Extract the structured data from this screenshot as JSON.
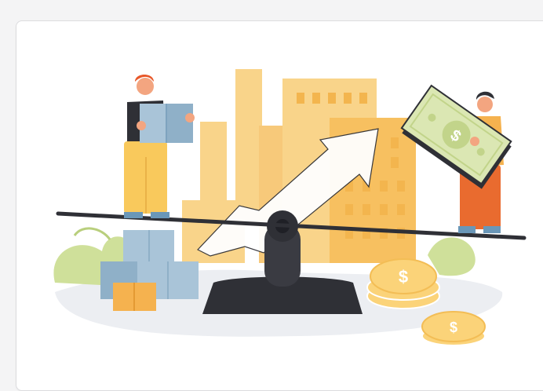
{
  "colors": {
    "background": "#f4f4f5",
    "card": "#ffffff",
    "factory": "#f9d48a",
    "factory_dark": "#f3c160",
    "arrow": "#ffffff",
    "seesaw": "#2f3036",
    "coin": "#fbd379",
    "money": "#dbe7b3",
    "box": "#8fb0c8",
    "box_light": "#a9c4d8",
    "box_orange": "#f5b24f",
    "bush": "#cfe09a",
    "ground": "#eceef2",
    "shirt_yellow": "#f5b24f",
    "hair": "#e8582a"
  },
  "illustration": {
    "icon": "supply-demand-balance-icon",
    "dollar_symbol": "$"
  }
}
